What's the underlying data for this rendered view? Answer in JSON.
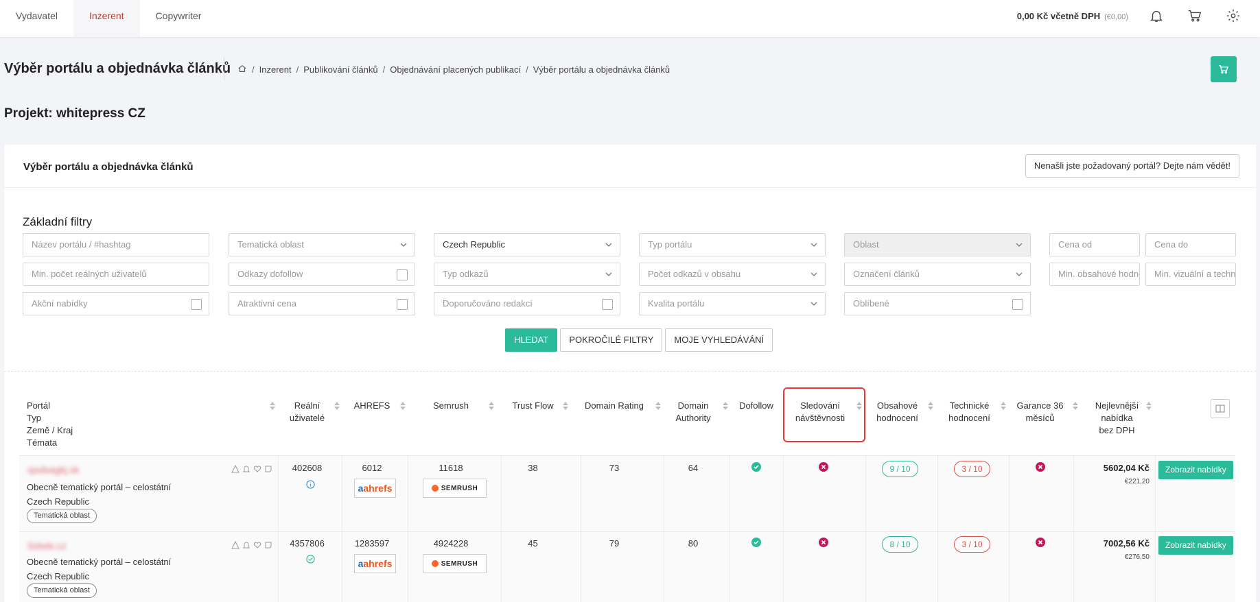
{
  "topnav": {
    "tabs": [
      "Vydavatel",
      "Inzerent",
      "Copywriter"
    ],
    "active": 1
  },
  "balance": {
    "amount": "0,00 Kč včetně DPH",
    "eur": "(€0,00)"
  },
  "header": {
    "title": "Výběr portálu a objednávka článků",
    "breadcrumb": [
      "Inzerent",
      "Publikování článků",
      "Objednávání placených publikací",
      "Výběr portálu a objednávka článků"
    ],
    "project": "Projekt: whitepress CZ"
  },
  "card": {
    "title": "Výběr portálu a objednávka článků",
    "feedback_button": "Nenašli jste požadovaný portál? Dejte nám vědět!"
  },
  "filters": {
    "title": "Základní filtry",
    "portal_name": "Název portálu / #hashtag",
    "thematic_area": "Tematická oblast",
    "country": "Czech Republic",
    "portal_type": "Typ portálu",
    "region": "Oblast",
    "price_from": "Cena od",
    "price_to": "Cena do",
    "min_users": "Min. počet reálných uživatelů",
    "dofollow": "Odkazy dofollow",
    "link_type": "Typ odkazů",
    "link_count": "Počet odkazů v obsahu",
    "article_marking": "Označení článků",
    "min_content": "Min. obsahové hodnocení",
    "min_visual": "Min. vizuální a technické",
    "promo": "Akční nabídky",
    "attractive_price": "Atraktivní cena",
    "recommended": "Doporučováno redakcí",
    "quality": "Kvalita portálu",
    "favorites": "Oblíbené"
  },
  "actions": {
    "search": "HLEDAT",
    "advanced": "POKROČILÉ FILTRY",
    "saved": "MOJE VYHLEDÁVÁNÍ"
  },
  "table": {
    "headers": {
      "portal": [
        "Portál",
        "Typ",
        "Země / Kraj",
        "Témata"
      ],
      "real_users": [
        "Reální",
        "uživatelé"
      ],
      "ahrefs": "AHREFS",
      "semrush": "Semrush",
      "trust_flow": "Trust Flow",
      "domain_rating": "Domain Rating",
      "domain_authority": [
        "Domain",
        "Authority"
      ],
      "dofollow": "Dofollow",
      "traffic": [
        "Sledování",
        "návštěvnosti"
      ],
      "content_rating": [
        "Obsahové",
        "hodnocení"
      ],
      "tech_rating": [
        "Technické",
        "hodnocení"
      ],
      "guarantee": [
        "Garance 36",
        "měsíců"
      ],
      "best_offer": [
        "Nejlevnější",
        "nabídka",
        "bez DPH"
      ]
    },
    "rows": [
      {
        "name": "sjsdsagkj.sk",
        "type": "Obecně tematický portál – celostátní",
        "country": "Czech Republic",
        "topic": "Tematická oblast",
        "users": "402608",
        "ahrefs": "6012",
        "semrush": "11618",
        "trust_flow": "38",
        "domain_rating": "73",
        "domain_authority": "64",
        "content": "9 / 10",
        "tech": "3 / 10",
        "price": "5602,04 Kč",
        "price_eur": "€221,20",
        "offer_button": "Zobrazit nabídky"
      },
      {
        "name": "Sdsds.cz",
        "type": "Obecně tematický portál – celostátní",
        "country": "Czech Republic",
        "topic": "Tematická oblast",
        "users": "4357806",
        "ahrefs": "1283597",
        "semrush": "4924228",
        "trust_flow": "45",
        "domain_rating": "79",
        "domain_authority": "80",
        "content": "8 / 10",
        "tech": "3 / 10",
        "price": "7002,56 Kč",
        "price_eur": "€276,50",
        "offer_button": "Zobrazit nabídky"
      }
    ],
    "logos": {
      "ahrefs": "ahrefs",
      "semrush": "SEMRUSH"
    }
  },
  "colors": {
    "accent": "#2bbb9a",
    "active_tab": "#c0392b",
    "danger": "#d9534f",
    "highlight": "#e53935"
  }
}
